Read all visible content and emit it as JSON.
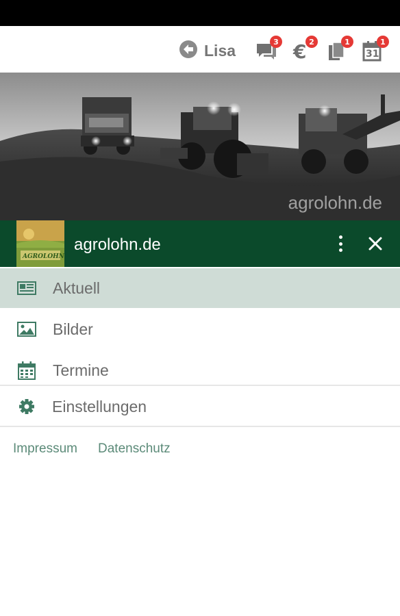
{
  "header": {
    "user_name": "Lisa",
    "icons": [
      {
        "name": "messages-icon",
        "badge": "3"
      },
      {
        "name": "euro-icon",
        "badge": "2"
      },
      {
        "name": "documents-icon",
        "badge": "1"
      },
      {
        "name": "calendar-icon",
        "badge": "1",
        "glyph": "31"
      }
    ]
  },
  "hero": {
    "watermark": "agrolohn.de"
  },
  "account": {
    "name": "agrolohn.de",
    "logo_text": "AGROLOHN"
  },
  "nav": {
    "items": [
      {
        "label": "Aktuell",
        "icon": "newspaper-icon",
        "active": true
      },
      {
        "label": "Bilder",
        "icon": "image-icon",
        "active": false
      },
      {
        "label": "Termine",
        "icon": "calendar-icon",
        "active": false
      },
      {
        "label": "Einstellungen",
        "icon": "gear-icon",
        "active": false
      }
    ]
  },
  "footer": {
    "impressum": "Impressum",
    "datenschutz": "Datenschutz"
  },
  "colors": {
    "primary": "#0b4a2b",
    "active_bg": "#cfdcd6",
    "badge": "#e53935",
    "icon_green": "#3e7a63"
  }
}
